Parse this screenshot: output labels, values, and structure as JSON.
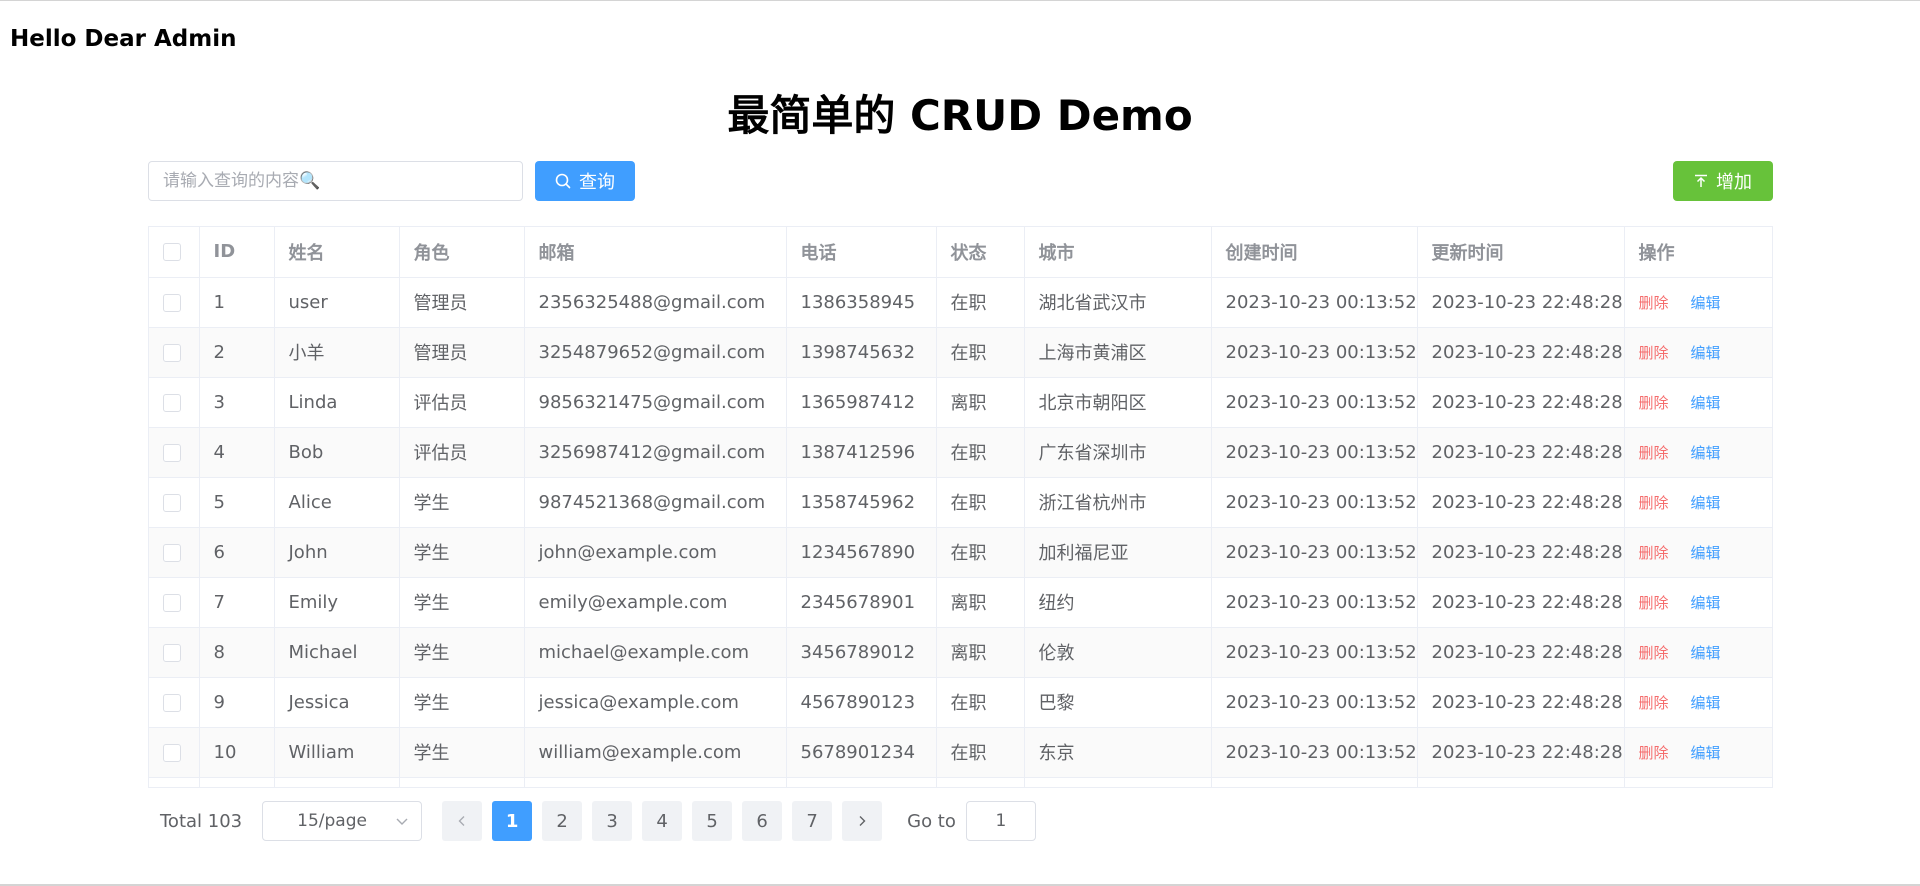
{
  "header": {
    "greeting": "Hello Dear Admin"
  },
  "page": {
    "title": "最简单的 CRUD Demo"
  },
  "toolbar": {
    "search_placeholder": "请输入查询的内容🔍",
    "search_value": "",
    "search_label": "查询",
    "add_label": "增加"
  },
  "table": {
    "columns": [
      "ID",
      "姓名",
      "角色",
      "邮箱",
      "电话",
      "状态",
      "城市",
      "创建时间",
      "更新时间",
      "操作"
    ],
    "delete_label": "删除",
    "edit_label": "编辑",
    "rows": [
      {
        "id": "1",
        "name": "user",
        "role": "管理员",
        "email": "2356325488@gmail.com",
        "phone": "1386358945",
        "status": "在职",
        "city": "湖北省武汉市",
        "created": "2023-10-23 00:13:52",
        "updated": "2023-10-23 22:48:28"
      },
      {
        "id": "2",
        "name": "小羊",
        "role": "管理员",
        "email": "3254879652@gmail.com",
        "phone": "1398745632",
        "status": "在职",
        "city": "上海市黄浦区",
        "created": "2023-10-23 00:13:52",
        "updated": "2023-10-23 22:48:28"
      },
      {
        "id": "3",
        "name": "Linda",
        "role": "评估员",
        "email": "9856321475@gmail.com",
        "phone": "1365987412",
        "status": "离职",
        "city": "北京市朝阳区",
        "created": "2023-10-23 00:13:52",
        "updated": "2023-10-23 22:48:28"
      },
      {
        "id": "4",
        "name": "Bob",
        "role": "评估员",
        "email": "3256987412@gmail.com",
        "phone": "1387412596",
        "status": "在职",
        "city": "广东省深圳市",
        "created": "2023-10-23 00:13:52",
        "updated": "2023-10-23 22:48:28"
      },
      {
        "id": "5",
        "name": "Alice",
        "role": "学生",
        "email": "9874521368@gmail.com",
        "phone": "1358745962",
        "status": "在职",
        "city": "浙江省杭州市",
        "created": "2023-10-23 00:13:52",
        "updated": "2023-10-23 22:48:28"
      },
      {
        "id": "6",
        "name": "John",
        "role": "学生",
        "email": "john@example.com",
        "phone": "1234567890",
        "status": "在职",
        "city": "加利福尼亚",
        "created": "2023-10-23 00:13:52",
        "updated": "2023-10-23 22:48:28"
      },
      {
        "id": "7",
        "name": "Emily",
        "role": "学生",
        "email": "emily@example.com",
        "phone": "2345678901",
        "status": "离职",
        "city": "纽约",
        "created": "2023-10-23 00:13:52",
        "updated": "2023-10-23 22:48:28"
      },
      {
        "id": "8",
        "name": "Michael",
        "role": "学生",
        "email": "michael@example.com",
        "phone": "3456789012",
        "status": "离职",
        "city": "伦敦",
        "created": "2023-10-23 00:13:52",
        "updated": "2023-10-23 22:48:28"
      },
      {
        "id": "9",
        "name": "Jessica",
        "role": "学生",
        "email": "jessica@example.com",
        "phone": "4567890123",
        "status": "在职",
        "city": "巴黎",
        "created": "2023-10-23 00:13:52",
        "updated": "2023-10-23 22:48:28"
      },
      {
        "id": "10",
        "name": "William",
        "role": "学生",
        "email": "william@example.com",
        "phone": "5678901234",
        "status": "在职",
        "city": "东京",
        "created": "2023-10-23 00:13:52",
        "updated": "2023-10-23 22:48:28"
      }
    ]
  },
  "pagination": {
    "total_label": "Total 103",
    "page_size": "15/page",
    "pages": [
      "1",
      "2",
      "3",
      "4",
      "5",
      "6",
      "7"
    ],
    "current_page": "1",
    "goto_label": "Go to",
    "goto_value": "1",
    "prev_icon": "chevron-left-icon",
    "next_icon": "chevron-right-icon"
  },
  "colors": {
    "primary": "#409eff",
    "success": "#67c23a",
    "danger": "#f56c6c"
  }
}
